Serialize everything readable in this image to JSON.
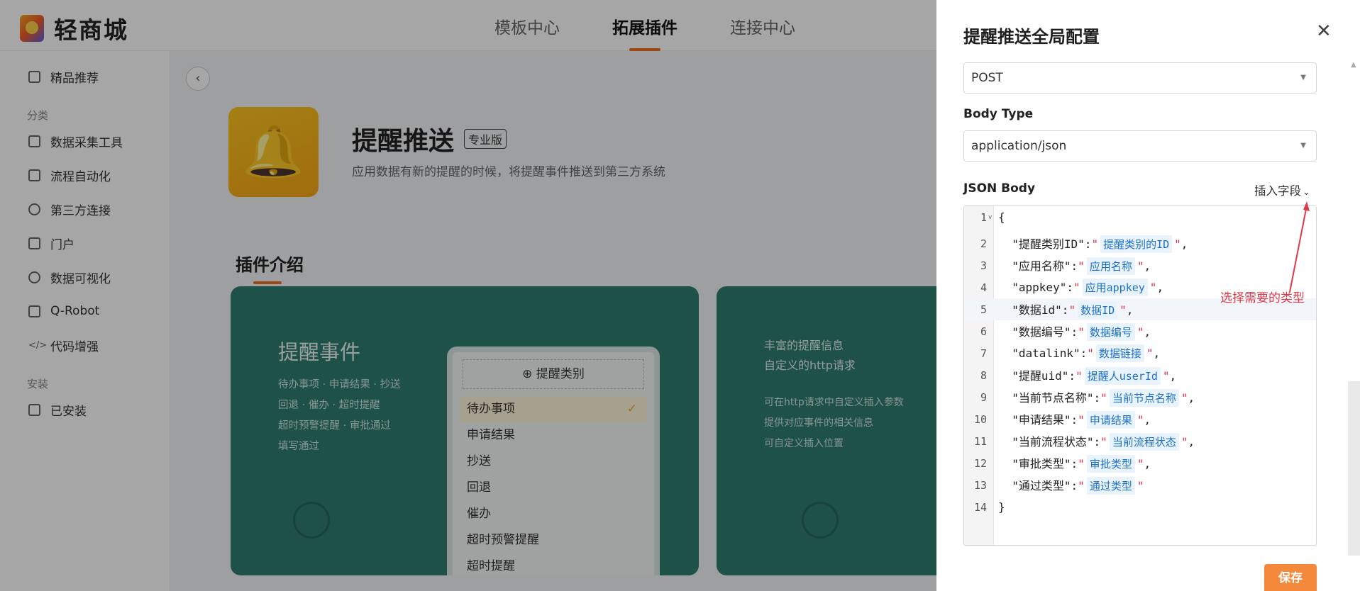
{
  "app": {
    "name": "轻商城",
    "nav": [
      "模板中心",
      "拓展插件",
      "连接中心"
    ],
    "nav_active": "拓展插件"
  },
  "sidebar": {
    "top_item": "精品推荐",
    "group_category": "分类",
    "categories": [
      "数据采集工具",
      "流程自动化",
      "第三方连接",
      "门户",
      "数据可视化",
      "Q-Robot",
      "代码增强"
    ],
    "group_install": "安装",
    "installed": "已安装"
  },
  "plugin": {
    "name": "提醒推送",
    "badge": "专业版",
    "description": "应用数据有新的提醒的时候，将提醒事件推送到第三方系统",
    "section": "插件介绍"
  },
  "card1": {
    "heading": "提醒事件",
    "lines": [
      "待办事项 · 申请结果 · 抄送",
      "回退 · 催办 · 超时提醒",
      "超时预警提醒 · 审批通过",
      "填写通过"
    ],
    "phone_header": "提醒类别",
    "phone_items": [
      "待办事项",
      "申请结果",
      "抄送",
      "回退",
      "催办",
      "超时预警提醒",
      "超时提醒"
    ]
  },
  "card2": {
    "heading_1": "丰富的提醒信息",
    "heading_2": "自定义的http请求",
    "lines": [
      "可在http请求中自定义插入参数",
      "提供对应事件的相关信息",
      "可自定义插入位置"
    ]
  },
  "drawer": {
    "title": "提醒推送全局配置",
    "method_value": "POST",
    "body_type_label": "Body Type",
    "body_type_value": "application/json",
    "json_body_label": "JSON Body",
    "insert_field": "插入字段",
    "annotation": "选择需要的类型",
    "save": "保存",
    "code_lines": [
      {
        "num": "1",
        "open": "{"
      },
      {
        "num": "2",
        "key": "提醒类别ID",
        "tag": "提醒类别的ID",
        "end": ","
      },
      {
        "num": "3",
        "key": "应用名称",
        "tag": "应用名称",
        "end": ","
      },
      {
        "num": "4",
        "key": "appkey",
        "tag": "应用appkey",
        "end": ","
      },
      {
        "num": "5",
        "key": "数据id",
        "tag": "数据ID",
        "end": ","
      },
      {
        "num": "6",
        "key": "数据编号",
        "tag": "数据编号",
        "end": ","
      },
      {
        "num": "7",
        "key": "datalink",
        "tag": "数据链接",
        "end": ","
      },
      {
        "num": "8",
        "key": "提醒uid",
        "tag": "提醒人userId",
        "end": ","
      },
      {
        "num": "9",
        "key": "当前节点名称",
        "tag": "当前节点名称",
        "end": ","
      },
      {
        "num": "10",
        "key": "申请结果",
        "tag": "申请结果",
        "end": ","
      },
      {
        "num": "11",
        "key": "当前流程状态",
        "tag": "当前流程状态",
        "end": ","
      },
      {
        "num": "12",
        "key": "审批类型",
        "tag": "审批类型",
        "end": ","
      },
      {
        "num": "13",
        "key": "通过类型",
        "tag": "通过类型",
        "end": ""
      },
      {
        "num": "14",
        "open": "}"
      }
    ]
  },
  "colors": {
    "accent": "#f26d21",
    "card": "#2f7d6f",
    "save": "#f5893b",
    "annotation": "#e03a4a",
    "tag_bg": "#e8f3fc",
    "tag_text": "#1e6fc6"
  }
}
